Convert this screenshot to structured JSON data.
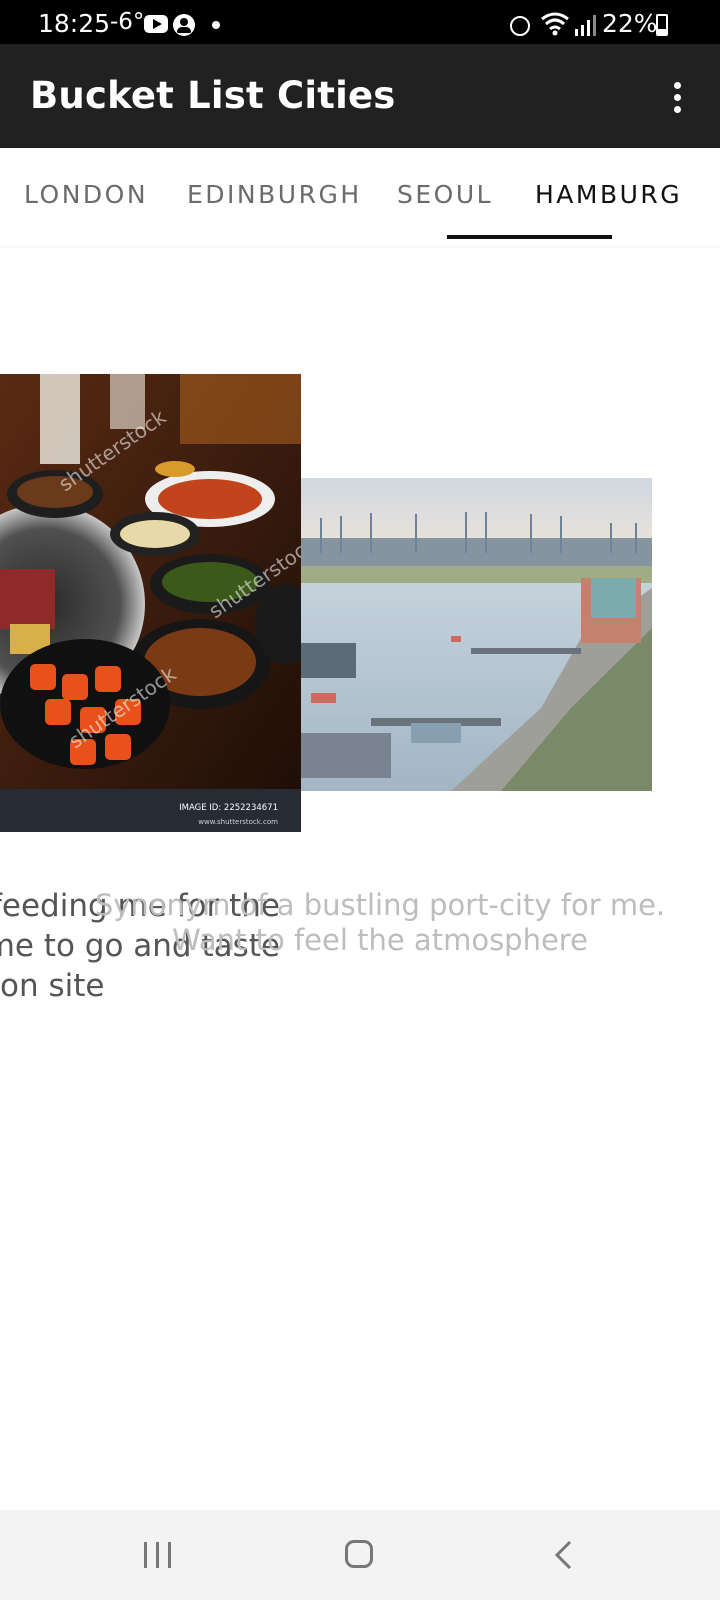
{
  "status_bar": {
    "time": "18:25",
    "temperature": "-6°",
    "battery": "22%",
    "icons": [
      "youtube-icon",
      "account-icon",
      "notification-dot-icon",
      "alarm-icon",
      "wifi-icon",
      "signal-icon",
      "battery-icon"
    ]
  },
  "app_bar": {
    "title": "Bucket List Cities",
    "menu_icon": "more-vert-icon"
  },
  "tabs": {
    "items": [
      {
        "label": "LONDON",
        "selected": false
      },
      {
        "label": "EDINBURGH",
        "selected": false
      },
      {
        "label": "SEOUL",
        "selected": false
      },
      {
        "label": "HAMBURG",
        "selected": true
      }
    ]
  },
  "pages": {
    "seoul": {
      "image_caption_line1": "IMAGE ID: 2252234671",
      "image_caption_line2": "www.shutterstock.com",
      "watermark": "shutterstock",
      "description_lines": [
        "feeding me for the",
        "me to go and taste",
        "on site"
      ]
    },
    "hamburg": {
      "description_line1": "Synonym of a bustling port-city for me.",
      "description_line2": "Want to feel the atmosphere"
    }
  },
  "nav_bar": {
    "icons": [
      "recent-apps-icon",
      "home-icon",
      "back-icon"
    ]
  },
  "colors": {
    "app_bar": "#212121",
    "tab_indicator": "#111111",
    "tab_inactive": "#6b6b6b",
    "nav_bar": "#f3f3f3"
  }
}
